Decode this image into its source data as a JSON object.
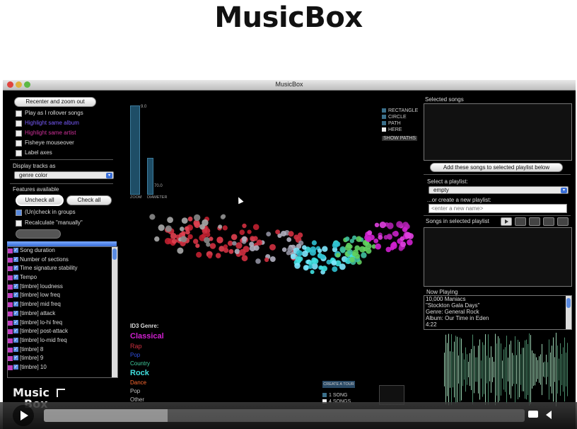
{
  "slide": {
    "title": "MusicBox"
  },
  "window": {
    "title": "MusicBox"
  },
  "left_panel": {
    "recenter_button": "Recenter and zoom out",
    "options": [
      {
        "label": "Play as I rollover songs",
        "checked": false,
        "color": "#dddddd"
      },
      {
        "label": "Highlight same album",
        "checked": false,
        "color": "#7a5cff"
      },
      {
        "label": "Highlight same artist",
        "checked": false,
        "color": "#d0309a"
      },
      {
        "label": "Fisheye mouseover",
        "checked": false,
        "color": "#dddddd"
      },
      {
        "label": "Label axes",
        "checked": false,
        "color": "#dddddd"
      }
    ],
    "display_tracks_label": "Display tracks as",
    "display_tracks_value": "genre color",
    "features_label": "Features available",
    "uncheck_all": "Uncheck all",
    "check_all": "Check all",
    "uncheck_groups": "(Un)check in groups",
    "recalculate": "Recalculate \"manually\"",
    "features": [
      "Song duration",
      "Number of sections",
      "Time signature stability",
      "Tempo",
      "[timbre] loudness",
      "[timbre] low freq",
      "[timbre] mid freq",
      "[timbre] attack",
      "[timbre] lo-hi freq",
      "[timbre] post-attack",
      "[timbre] lo-mid freq",
      "[timbre] 8",
      "[timbre] 9",
      "[timbre] 10"
    ]
  },
  "center": {
    "gauge_top": "9.0",
    "gauge_bottom": "70.0",
    "zoom_label": "ZOOM",
    "diameter_label": "DIAMETER",
    "shape_legend": [
      "RECTANGLE",
      "CIRCLE",
      "PATH",
      "HERE"
    ],
    "show_paths": "SHOW PATHS",
    "genre_title": "ID3 Genre:",
    "genres": [
      {
        "name": "Classical",
        "color": "#d020d0"
      },
      {
        "name": "Rap",
        "color": "#d03040"
      },
      {
        "name": "Pop",
        "color": "#3050e0"
      },
      {
        "name": "Country",
        "color": "#40d0a0"
      },
      {
        "name": "Rock",
        "color": "#40e0e0"
      },
      {
        "name": "Dance",
        "color": "#ff6a30"
      },
      {
        "name": "Pop",
        "color": "#c0c0c0"
      },
      {
        "name": "Other",
        "color": "#c0c0c0"
      }
    ],
    "create_tour": "CREATE A TOUR",
    "tour_legend": [
      "1 SONG",
      "4 SONGS"
    ]
  },
  "right_panel": {
    "selected_songs_label": "Selected songs",
    "add_button": "Add these songs to selected playlist below",
    "select_playlist_label": "Select a playlist:",
    "playlist_value": "empty",
    "create_label": "...or create a new playlist:",
    "new_name_placeholder": "<enter a new name>",
    "songs_in_playlist": "Songs in selected playlist",
    "now_playing_label": "Now Playing",
    "now_playing": [
      "10,000 Maniacs",
      "\"Stockton Gala Days\"",
      "Genre: General Rock",
      "Album: Our Time in Eden",
      "4:22"
    ]
  },
  "logo": {
    "line1": "Music",
    "line2": "Box"
  }
}
